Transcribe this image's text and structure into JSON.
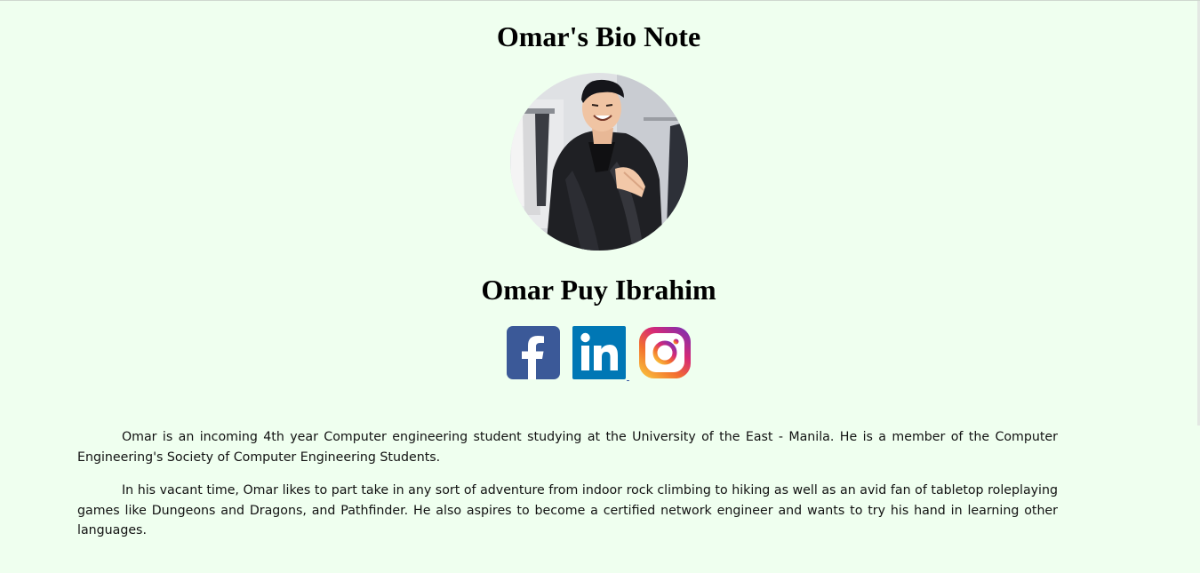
{
  "page": {
    "title": "Omar's Bio Note",
    "background": "#efffef"
  },
  "profile": {
    "name": "Omar Puy Ibrahim",
    "avatar_icon": "profile-photo"
  },
  "social": [
    {
      "name": "facebook",
      "icon": "facebook-icon",
      "color": "#3b5998"
    },
    {
      "name": "linkedin",
      "icon": "linkedin-icon",
      "color": "#0077b5"
    },
    {
      "name": "instagram",
      "icon": "instagram-icon",
      "color": "#c13584"
    }
  ],
  "bio": {
    "paragraphs": [
      "Omar is an incoming 4th year Computer engineering student studying at the University of the East - Manila. He is a member of the Computer Engineering's Society of Computer Engineering Students.",
      "In his vacant time, Omar likes to part take in any sort of adventure from indoor rock climbing to hiking as well as an avid fan of tabletop roleplaying games like Dungeons and Dragons, and Pathfinder. He also aspires to become a certified network engineer and wants to try his hand in learning other languages."
    ]
  }
}
